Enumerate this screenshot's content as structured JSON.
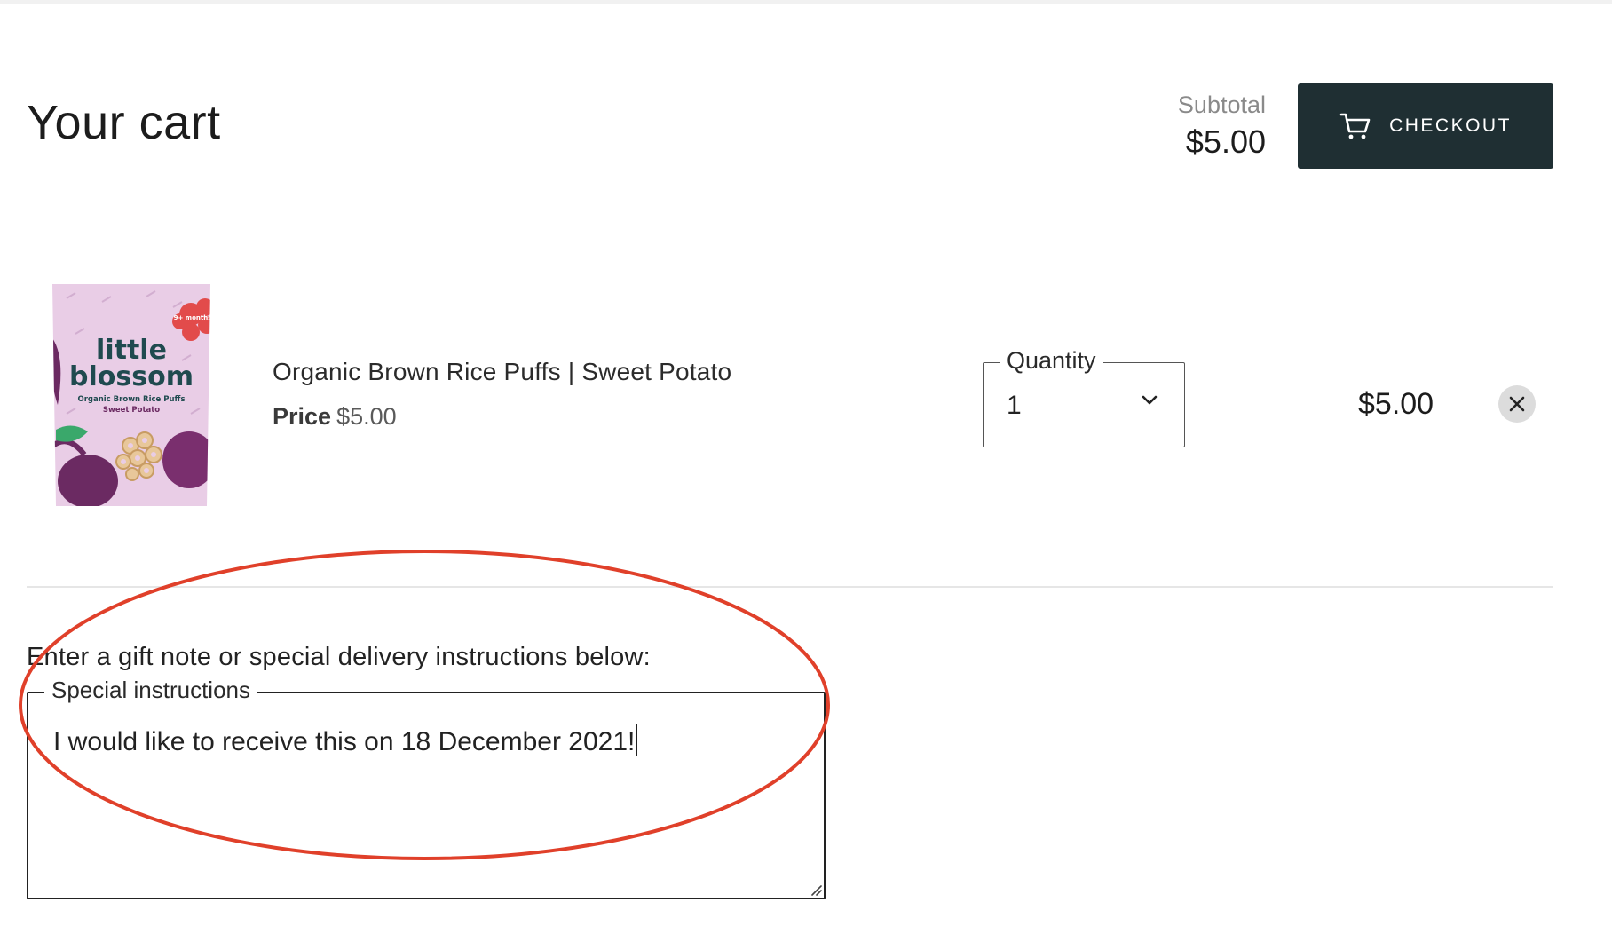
{
  "header": {
    "title": "Your cart",
    "subtotal_label": "Subtotal",
    "subtotal_value": "$5.00",
    "checkout_label": "CHECKOUT",
    "checkout_icon": "cart-icon"
  },
  "cart": {
    "items": [
      {
        "image_alt": "little blossom Organic Brown Rice Puffs Sweet Potato",
        "image_texts": {
          "badge": "9+ months",
          "brand_line1": "little",
          "brand_line2": "blossom",
          "product_line1": "Organic Brown Rice Puffs",
          "product_line2": "Sweet Potato"
        },
        "name": "Organic Brown Rice Puffs | Sweet Potato",
        "price_label": "Price",
        "price_value": "$5.00",
        "quantity_label": "Quantity",
        "quantity_value": "1",
        "line_total": "$5.00",
        "remove_icon": "close-icon"
      }
    ]
  },
  "notes": {
    "prompt": "Enter a gift note or special delivery instructions below:",
    "field_label": "Special instructions",
    "field_value": "I would like to receive this on 18 December 2021!"
  },
  "annotation": {
    "color": "#e0402a",
    "shape": "ellipse"
  },
  "colors": {
    "checkout_bg": "#1f2f33",
    "package_bg": "#e9cde6",
    "brand_text": "#1f4a4f"
  }
}
